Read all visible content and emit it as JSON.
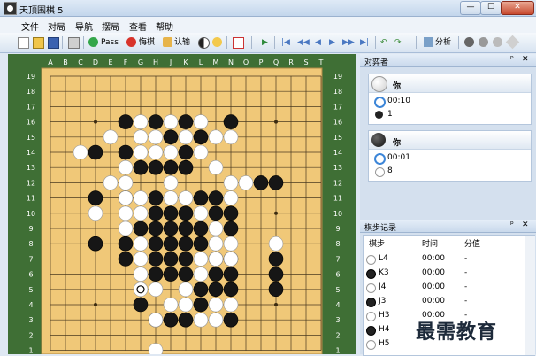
{
  "window": {
    "title": "天顶围棋 5",
    "min": "—",
    "max": "☐",
    "close": "✕"
  },
  "menu": [
    "文件",
    "对局",
    "导航",
    "摆局",
    "查看",
    "帮助"
  ],
  "toolbar": {
    "pass": "Pass",
    "undo": "悔棋",
    "resign": "认输",
    "analysis": "分析"
  },
  "board": {
    "columns": [
      "A",
      "B",
      "C",
      "D",
      "E",
      "F",
      "G",
      "H",
      "J",
      "K",
      "L",
      "M",
      "N",
      "O",
      "P",
      "Q",
      "R",
      "S",
      "T"
    ],
    "rows": [
      "19",
      "18",
      "17",
      "16",
      "15",
      "14",
      "13",
      "12",
      "11",
      "10",
      "9",
      "8",
      "7",
      "6",
      "5",
      "4",
      "3",
      "2",
      "1"
    ],
    "black": [
      "F16",
      "H16",
      "K16",
      "N16",
      "J15",
      "L15",
      "D14",
      "F14",
      "K14",
      "H13",
      "G13",
      "J13",
      "K13",
      "Q12",
      "P12",
      "D11",
      "F11",
      "H11",
      "L11",
      "M11",
      "H10",
      "J10",
      "K10",
      "M10",
      "N10",
      "G9",
      "H9",
      "J9",
      "K9",
      "L9",
      "N9",
      "D8",
      "F8",
      "H8",
      "J8",
      "K8",
      "L8",
      "F7",
      "H7",
      "J7",
      "K7",
      "M7",
      "N7",
      "Q7",
      "H6",
      "J6",
      "K6",
      "M6",
      "N6",
      "Q6",
      "L5",
      "M5",
      "N5",
      "Q5",
      "G4",
      "L4",
      "K3",
      "J3",
      "H3",
      "N3"
    ],
    "white": [
      "G16",
      "J16",
      "L16",
      "E15",
      "G15",
      "H15",
      "K15",
      "M15",
      "N15",
      "C14",
      "G14",
      "H14",
      "J14",
      "L14",
      "F13",
      "M13",
      "E12",
      "F12",
      "J12",
      "N12",
      "O12",
      "F11",
      "G11",
      "J11",
      "K11",
      "N11",
      "D10",
      "F10",
      "G10",
      "L10",
      "F9",
      "M9",
      "G8",
      "M8",
      "N8",
      "G7",
      "L7",
      "M7",
      "N7",
      "Q8",
      "G6",
      "L6",
      "G5",
      "H5",
      "K5",
      "J4",
      "K4",
      "M4",
      "N4",
      "H3",
      "L3",
      "M3",
      "H1"
    ],
    "last_move": "G5"
  },
  "panel": {
    "players_title": "对弈者",
    "pin": "ᵖ",
    "close": "✕",
    "white_player": {
      "name": "你",
      "time": "00:10",
      "captures": "1"
    },
    "black_player": {
      "name": "你",
      "time": "00:01",
      "captures": "8"
    },
    "moves_title": "棋步记录",
    "moves_headers": [
      "棋步",
      "时间",
      "分值"
    ],
    "moves": [
      {
        "color": "white",
        "move": "L4",
        "time": "00:00",
        "score": "-"
      },
      {
        "color": "black",
        "move": "K3",
        "time": "00:00",
        "score": "-"
      },
      {
        "color": "white",
        "move": "J4",
        "time": "00:00",
        "score": "-"
      },
      {
        "color": "black",
        "move": "J3",
        "time": "00:00",
        "score": "-"
      },
      {
        "color": "white",
        "move": "H3",
        "time": "00:00",
        "score": "-"
      },
      {
        "color": "black",
        "move": "H4",
        "time": "0",
        "score": ""
      },
      {
        "color": "white",
        "move": "H5",
        "time": "",
        "score": ""
      }
    ]
  },
  "watermark": "最需教育",
  "colors": {
    "board": "#f0c878",
    "frame": "#3f6f35",
    "black_stone": "#161616",
    "white_stone": "#ffffff",
    "accent": "#3d86d8"
  }
}
